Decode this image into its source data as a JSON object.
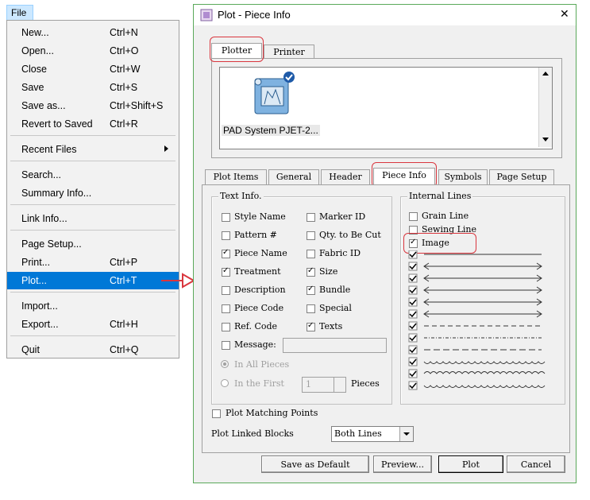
{
  "menu": {
    "title": "File",
    "items": [
      {
        "label": "New...",
        "shortcut": "Ctrl+N"
      },
      {
        "label": "Open...",
        "shortcut": "Ctrl+O"
      },
      {
        "label": "Close",
        "shortcut": "Ctrl+W"
      },
      {
        "label": "Save",
        "shortcut": "Ctrl+S"
      },
      {
        "label": "Save as...",
        "shortcut": "Ctrl+Shift+S"
      },
      {
        "label": "Revert to Saved",
        "shortcut": "Ctrl+R"
      },
      {
        "label": "Recent Files",
        "shortcut": ""
      },
      {
        "label": "Search...",
        "shortcut": ""
      },
      {
        "label": "Summary Info...",
        "shortcut": ""
      },
      {
        "label": "Link Info...",
        "shortcut": ""
      },
      {
        "label": "Page Setup...",
        "shortcut": ""
      },
      {
        "label": "Print...",
        "shortcut": "Ctrl+P"
      },
      {
        "label": "Plot...",
        "shortcut": "Ctrl+T"
      },
      {
        "label": "Import...",
        "shortcut": ""
      },
      {
        "label": "Export...",
        "shortcut": "Ctrl+H"
      },
      {
        "label": "Quit",
        "shortcut": "Ctrl+Q"
      }
    ]
  },
  "dialog": {
    "title": "Plot - Piece Info",
    "close": "✕",
    "device_tabs": [
      "Plotter",
      "Printer"
    ],
    "device_name": "PAD System PJET-2...",
    "tabs": [
      "Plot Items",
      "General",
      "Header",
      "Piece Info",
      "Symbols",
      "Page Setup"
    ],
    "text_info": {
      "label": "Text Info.",
      "col1": [
        {
          "label": "Style Name",
          "checked": false
        },
        {
          "label": "Pattern #",
          "checked": false
        },
        {
          "label": "Piece Name",
          "checked": true
        },
        {
          "label": "Treatment",
          "checked": true
        },
        {
          "label": "Description",
          "checked": false
        },
        {
          "label": "Piece Code",
          "checked": false
        },
        {
          "label": "Ref. Code",
          "checked": false
        }
      ],
      "col2": [
        {
          "label": "Marker ID",
          "checked": false
        },
        {
          "label": "Qty. to Be Cut",
          "checked": false
        },
        {
          "label": "Fabric ID",
          "checked": false
        },
        {
          "label": "Size",
          "checked": true
        },
        {
          "label": "Bundle",
          "checked": true
        },
        {
          "label": "Special",
          "checked": false
        },
        {
          "label": "Texts",
          "checked": true
        }
      ],
      "message_label": "Message:",
      "in_all": "In All Pieces",
      "in_first": "In the First",
      "in_first_value": "1",
      "pieces": "Pieces"
    },
    "internal_lines": {
      "label": "Internal Lines",
      "grain": "Grain Line",
      "sewing": "Sewing Line",
      "image": "Image"
    },
    "plot_matching": "Plot Matching Points",
    "linked_label": "Plot Linked Blocks",
    "linked_value": "Both Lines",
    "buttons": {
      "save_default": "Save as Default",
      "preview": "Preview...",
      "plot": "Plot",
      "cancel": "Cancel"
    }
  }
}
